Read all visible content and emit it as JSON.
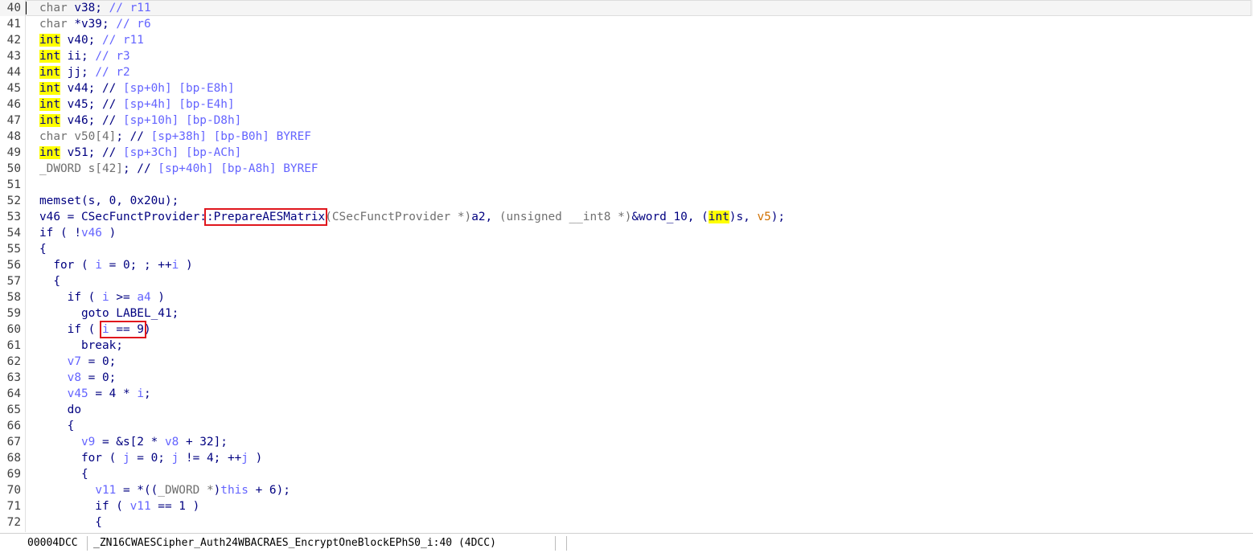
{
  "editor": {
    "current_line": 40,
    "lines": [
      {
        "n": "40",
        "tokens": [
          [
            "char",
            "g"
          ],
          [
            " v38; ",
            "gd"
          ],
          [
            "// r11",
            "c"
          ]
        ]
      },
      {
        "n": "41",
        "tokens": [
          [
            "char",
            "g"
          ],
          [
            " *v39; ",
            "gd"
          ],
          [
            "// r6",
            "c"
          ]
        ]
      },
      {
        "n": "42",
        "tokens": [
          [
            "int",
            "hl"
          ],
          [
            " v40; ",
            "gd"
          ],
          [
            "// r11",
            "c"
          ]
        ]
      },
      {
        "n": "43",
        "tokens": [
          [
            "int",
            "hl"
          ],
          [
            " ii; ",
            "gd"
          ],
          [
            "// r3",
            "c"
          ]
        ]
      },
      {
        "n": "44",
        "tokens": [
          [
            "int",
            "hl"
          ],
          [
            " jj; ",
            "gd"
          ],
          [
            "// r2",
            "c"
          ]
        ]
      },
      {
        "n": "45",
        "tokens": [
          [
            "int",
            "hl"
          ],
          [
            " v44; // ",
            "gd"
          ],
          [
            "[sp+0h] [bp-E8h]",
            "c"
          ]
        ]
      },
      {
        "n": "46",
        "tokens": [
          [
            "int",
            "hl"
          ],
          [
            " v45; // ",
            "gd"
          ],
          [
            "[sp+4h] [bp-E4h]",
            "c"
          ]
        ]
      },
      {
        "n": "47",
        "tokens": [
          [
            "int",
            "hl"
          ],
          [
            " v46; // ",
            "gd"
          ],
          [
            "[sp+10h] [bp-D8h]",
            "c"
          ]
        ]
      },
      {
        "n": "48",
        "tokens": [
          [
            "char v50[4]",
            "g"
          ],
          [
            "; // ",
            "gd"
          ],
          [
            "[sp+38h] [bp-B0h] BYREF",
            "c"
          ]
        ]
      },
      {
        "n": "49",
        "tokens": [
          [
            "int",
            "hl"
          ],
          [
            " v51; // ",
            "gd"
          ],
          [
            "[sp+3Ch] [bp-ACh]",
            "c"
          ]
        ]
      },
      {
        "n": "50",
        "tokens": [
          [
            "_DWORD s[42]",
            "g"
          ],
          [
            "; // ",
            "gd"
          ],
          [
            "[sp+40h] [bp-A8h] BYREF",
            "c"
          ]
        ]
      },
      {
        "n": "51",
        "tokens": []
      },
      {
        "n": "52",
        "tokens": [
          [
            "memset(s, 0, 0x20u);",
            "p"
          ]
        ]
      },
      {
        "n": "53",
        "tokens": [
          [
            "v46 = CSecFunctProvider:",
            "p"
          ],
          [
            ":PrepareAESMatrix",
            "box"
          ],
          [
            "(CSecFunctProvider *)",
            "g"
          ],
          [
            "a2, ",
            "p"
          ],
          [
            "(unsigned __int8 *)",
            "g"
          ],
          [
            "&word_10, (",
            "p"
          ],
          [
            "int",
            "hl"
          ],
          [
            ")s, ",
            "p"
          ],
          [
            "v5",
            "vs"
          ],
          [
            ");",
            "p"
          ]
        ]
      },
      {
        "n": "54",
        "tokens": [
          [
            "if ( !",
            "p"
          ],
          [
            "v46",
            "v"
          ],
          [
            " )",
            "p"
          ]
        ]
      },
      {
        "n": "55",
        "tokens": [
          [
            "{",
            "p"
          ]
        ]
      },
      {
        "n": "56",
        "tokens": [
          [
            "  for ( ",
            "p"
          ],
          [
            "i",
            "v"
          ],
          [
            " = 0; ; ++",
            "p"
          ],
          [
            "i",
            "v"
          ],
          [
            " )",
            "p"
          ]
        ]
      },
      {
        "n": "57",
        "tokens": [
          [
            "  {",
            "p"
          ]
        ]
      },
      {
        "n": "58",
        "tokens": [
          [
            "    if ( ",
            "p"
          ],
          [
            "i",
            "v"
          ],
          [
            " >= ",
            "p"
          ],
          [
            "a4",
            "v"
          ],
          [
            " )",
            "p"
          ]
        ]
      },
      {
        "n": "59",
        "tokens": [
          [
            "      goto LABEL_41;",
            "p"
          ]
        ]
      },
      {
        "n": "60",
        "tokens": [
          [
            "    if ( ",
            "p"
          ],
          [
            "i == 9",
            "box2"
          ],
          [
            ")",
            "p"
          ]
        ]
      },
      {
        "n": "61",
        "tokens": [
          [
            "      break;",
            "p"
          ]
        ]
      },
      {
        "n": "62",
        "tokens": [
          [
            "    ",
            "p"
          ],
          [
            "v7",
            "v"
          ],
          [
            " = 0;",
            "p"
          ]
        ]
      },
      {
        "n": "63",
        "tokens": [
          [
            "    ",
            "p"
          ],
          [
            "v8",
            "v"
          ],
          [
            " = 0;",
            "p"
          ]
        ]
      },
      {
        "n": "64",
        "tokens": [
          [
            "    ",
            "p"
          ],
          [
            "v45",
            "v"
          ],
          [
            " = 4 * ",
            "p"
          ],
          [
            "i",
            "v"
          ],
          [
            ";",
            "p"
          ]
        ]
      },
      {
        "n": "65",
        "tokens": [
          [
            "    do",
            "p"
          ]
        ]
      },
      {
        "n": "66",
        "tokens": [
          [
            "    {",
            "p"
          ]
        ]
      },
      {
        "n": "67",
        "tokens": [
          [
            "      ",
            "p"
          ],
          [
            "v9",
            "v"
          ],
          [
            " = &s[2 * ",
            "p"
          ],
          [
            "v8",
            "v"
          ],
          [
            " + 32];",
            "p"
          ]
        ]
      },
      {
        "n": "68",
        "tokens": [
          [
            "      for ( ",
            "p"
          ],
          [
            "j",
            "v"
          ],
          [
            " = 0; ",
            "p"
          ],
          [
            "j",
            "v"
          ],
          [
            " != 4; ++",
            "p"
          ],
          [
            "j",
            "v"
          ],
          [
            " )",
            "p"
          ]
        ]
      },
      {
        "n": "69",
        "tokens": [
          [
            "      {",
            "p"
          ]
        ]
      },
      {
        "n": "70",
        "tokens": [
          [
            "        ",
            "p"
          ],
          [
            "v11",
            "v"
          ],
          [
            " = *((",
            "p"
          ],
          [
            "_DWORD *",
            "g"
          ],
          [
            ")",
            "p"
          ],
          [
            "this",
            "v"
          ],
          [
            " + 6);",
            "p"
          ]
        ]
      },
      {
        "n": "71",
        "tokens": [
          [
            "        if ( ",
            "p"
          ],
          [
            "v11",
            "v"
          ],
          [
            " == 1 )",
            "p"
          ]
        ]
      },
      {
        "n": "72",
        "tokens": [
          [
            "        {",
            "p"
          ]
        ]
      }
    ]
  },
  "statusbar": {
    "address": "00004DCC",
    "location": "_ZN16CWAESCipher_Auth24WBACRAES_EncryptOneBlockEPhS0_i:40 (4DCC)"
  },
  "colors": {
    "highlight": "#ffff00",
    "annotation_box": "#e0161d",
    "variable": "#6464ff",
    "plain": "#000080",
    "type_gray": "#707070",
    "arg_orange": "#d07000"
  }
}
